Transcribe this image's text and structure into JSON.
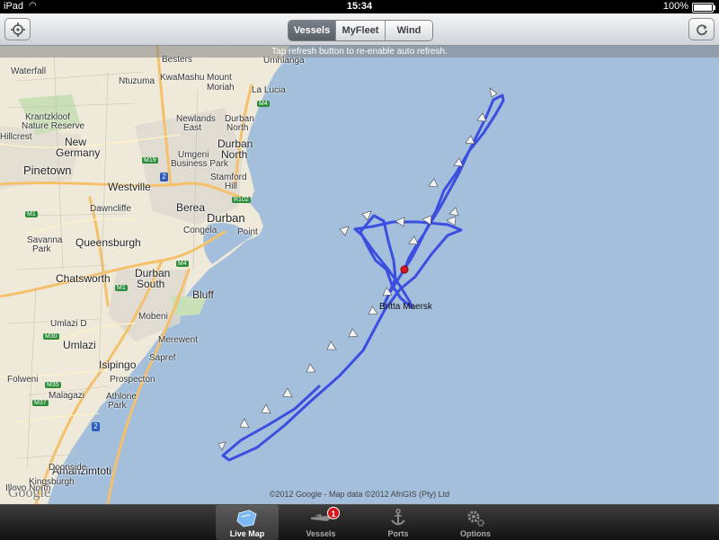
{
  "status_bar": {
    "device": "iPad",
    "time": "15:34",
    "battery": "100%"
  },
  "toolbar": {
    "segments": [
      {
        "label": "Vessels",
        "selected": true
      },
      {
        "label": "MyFleet",
        "selected": false
      },
      {
        "label": "Wind",
        "selected": false
      }
    ],
    "left_icon": "locate-crosshair-icon",
    "right_icon": "refresh-icon"
  },
  "map": {
    "hint": "Tap refresh button to re-enable auto refresh.",
    "vessel_name": "Britta Maersk",
    "copyright": "©2012 Google -  Map data ©2012 AfriGIS (Pty) Ltd",
    "logo": "Google",
    "places": {
      "p1": "Waterfall",
      "p2": "Besters",
      "p3": "Umhlanga",
      "p4": "Ntuzuma",
      "p5": "KwaMashu",
      "p6": "Mount",
      "p7": "Moriah",
      "p8": "La Lucia",
      "p9": "Krantzkloof",
      "p10": "Nature Reserve",
      "p11": "Hillcrest",
      "p12": "Newlands",
      "p13": "East",
      "p14": "Durban",
      "p15": "North",
      "p16": "New",
      "p17": "Germany",
      "p18": "Durban",
      "p19": "North",
      "p20": "Umgeni",
      "p21": "Business Park",
      "p22": "Pinetown",
      "p23": "Westville",
      "p24": "Stamford",
      "p25": "Hill",
      "p26": "Dawncliffe",
      "p27": "Berea",
      "p28": "Durban",
      "p29": "Congela",
      "p30": "Point",
      "p31": "Savanna",
      "p32": "Park",
      "p33": "Queensburgh",
      "p34": "Chatsworth",
      "p35": "Durban",
      "p36": "South",
      "p37": "Bluff",
      "p38": "Mobeni",
      "p39": "Umlazi D",
      "p40": "Umlazi",
      "p41": "Merewent",
      "p42": "Sapref",
      "p43": "Isipingo",
      "p44": "Prospecton",
      "p45": "Folweni",
      "p46": "Athlone",
      "p47": "Park",
      "p48": "Malagazi",
      "p49": "Amanzimtoti",
      "p50": "Illovo North",
      "p51": "Doonside",
      "p52": "Kingsburgh"
    },
    "routes": {
      "r1": "M4",
      "r2": "M19",
      "r3": "R102",
      "r4": "M1",
      "r5": "M1",
      "r6": "M4",
      "r7": "M30",
      "r8": "M35",
      "r9": "M37",
      "r10": "2",
      "r11": "2"
    }
  },
  "tabbar": {
    "items": [
      {
        "label": "Live Map",
        "active": true
      },
      {
        "label": "Vessels",
        "badge": "1"
      },
      {
        "label": "Ports"
      },
      {
        "label": "Options"
      }
    ]
  }
}
